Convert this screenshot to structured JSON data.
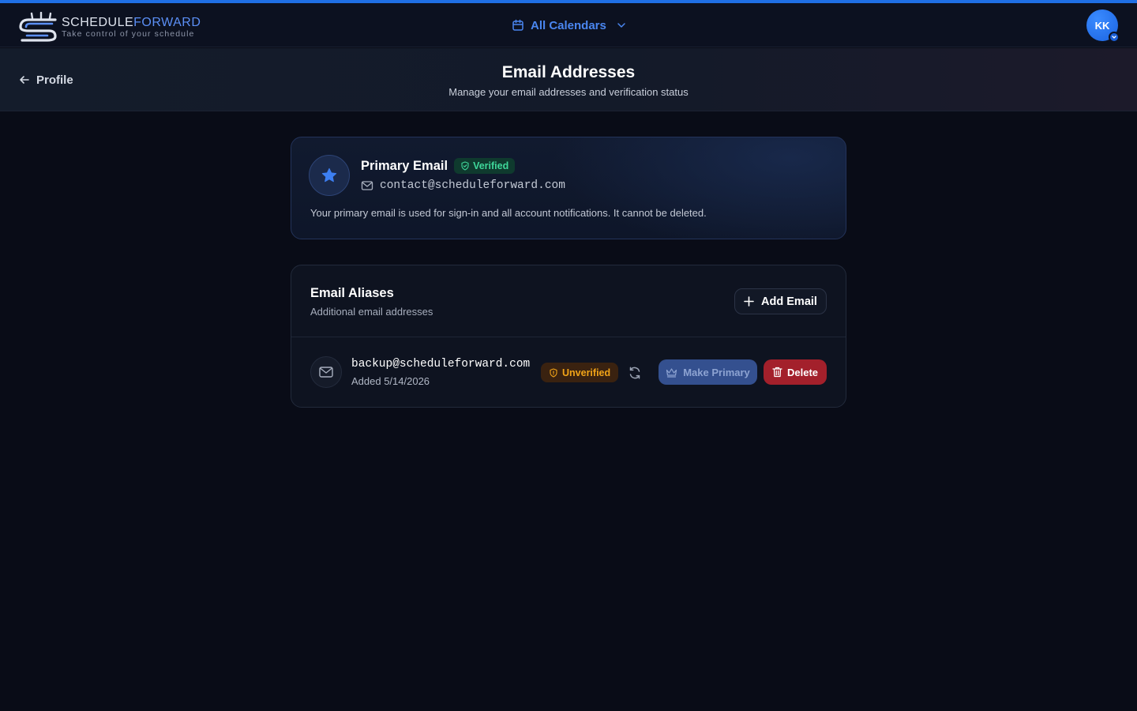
{
  "app": {
    "name_part1": "SCHEDULE",
    "name_part2": "FORWARD",
    "tagline": "Take control of your schedule"
  },
  "header": {
    "calendar_switch": "All Calendars",
    "avatar_initials": "KK"
  },
  "subheader": {
    "back_label": "Profile",
    "title": "Email Addresses",
    "subtitle": "Manage your email addresses and verification status"
  },
  "primary": {
    "title": "Primary Email",
    "status": "Verified",
    "email": "contact@scheduleforward.com",
    "note": "Your primary email is used for sign-in and all account notifications. It cannot be deleted."
  },
  "aliases": {
    "title": "Email Aliases",
    "subtitle": "Additional email addresses",
    "add_label": "Add Email",
    "items": [
      {
        "email": "backup@scheduleforward.com",
        "added": "Added 5/14/2026",
        "status": "Unverified",
        "make_primary_label": "Make Primary",
        "delete_label": "Delete"
      }
    ]
  },
  "colors": {
    "accent": "#1f6fe5",
    "verified": "#3fd79a",
    "unverified": "#f2a418",
    "danger": "#a3202b"
  },
  "icons": [
    "logo-mark",
    "calendar-icon",
    "chevron-down-icon",
    "arrow-left-icon",
    "star-icon",
    "shield-check-icon",
    "mail-icon",
    "plus-icon",
    "shield-alert-icon",
    "refresh-icon",
    "crown-icon",
    "trash-icon"
  ]
}
